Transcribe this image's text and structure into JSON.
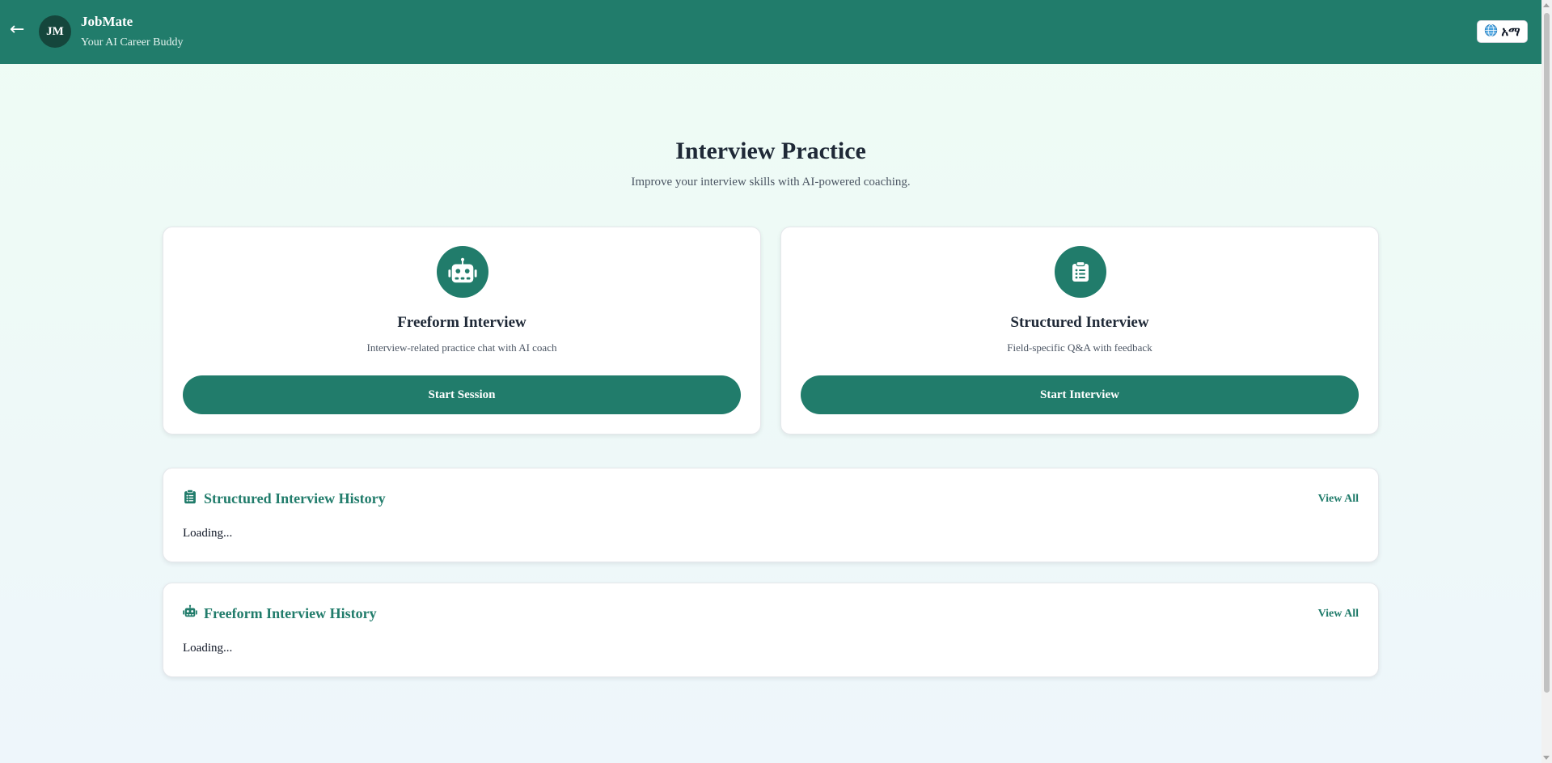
{
  "header": {
    "back_icon": "arrow-left-icon",
    "avatar_initials": "JM",
    "app_name": "JobMate",
    "tagline": "Your AI Career Buddy",
    "language_icon": "globe-icon",
    "language_label": "አማ",
    "color": "#217c6b"
  },
  "page": {
    "title": "Interview Practice",
    "subtitle": "Improve your interview skills with AI-powered coaching."
  },
  "modes": [
    {
      "icon": "robot-icon",
      "title": "Freeform Interview",
      "description": "Interview-related practice chat with AI coach",
      "button_label": "Start Session"
    },
    {
      "icon": "clipboard-list-icon",
      "title": "Structured Interview",
      "description": "Field-specific Q&A with feedback",
      "button_label": "Start Interview"
    }
  ],
  "history": [
    {
      "icon": "clipboard-list-icon",
      "title": "Structured Interview History",
      "view_all_label": "View All",
      "status": "Loading..."
    },
    {
      "icon": "robot-icon",
      "title": "Freeform Interview History",
      "view_all_label": "View All",
      "status": "Loading..."
    }
  ],
  "colors": {
    "primary": "#217c6b",
    "avatar_bg": "#15463c"
  }
}
